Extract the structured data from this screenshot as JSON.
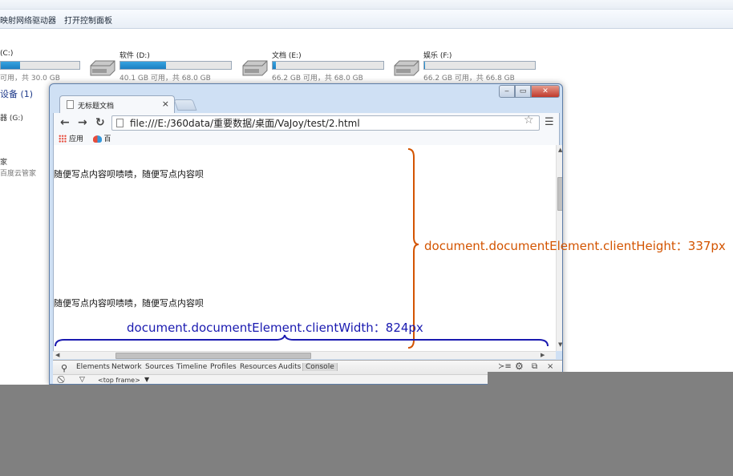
{
  "explorer": {
    "toolbar": [
      "映射网络驱动器",
      "打开控制面板"
    ],
    "drives": [
      {
        "name": "(C:)",
        "size": "可用，共 30.0 GB",
        "used": 0.24
      },
      {
        "name": "软件 (D:)",
        "size": "40.1 GB 可用，共 68.0 GB",
        "used": 0.41
      },
      {
        "name": "文档 (E:)",
        "size": "66.2 GB 可用，共 68.0 GB",
        "used": 0.03
      },
      {
        "name": "娱乐 (F:)",
        "size": "66.2 GB 可用，共 66.8 GB",
        "used": 0.01
      }
    ],
    "section": "设备 (1)",
    "device": "器 (G:)",
    "other": [
      "家",
      "百度云管家"
    ]
  },
  "browser": {
    "tab_title": "无标题文档",
    "tab_close": "×",
    "url": "file:///E:/360data/重要数据/桌面/VaJoy/test/2.html",
    "bookmarks": [
      "应用",
      "百"
    ],
    "content_lines": [
      "随便写点内容呗啧啧，随便写点内容呗",
      "随便写点内容呗啧啧，随便写点内容呗"
    ],
    "devtools_tabs": [
      "Elements",
      "Network",
      "Sources",
      "Timeline",
      "Profiles",
      "Resources",
      "Audits",
      "Console"
    ],
    "devtools_frame": "<top frame>",
    "window_buttons": {
      "min": "‒",
      "max": "▭",
      "close": "✕"
    }
  },
  "annotations": {
    "height_label": "document.documentElement.clientHeight：337px",
    "width_label": "document.documentElement.clientWidth：824px",
    "height_color": "#d35400",
    "width_color": "#1a1ab0"
  }
}
